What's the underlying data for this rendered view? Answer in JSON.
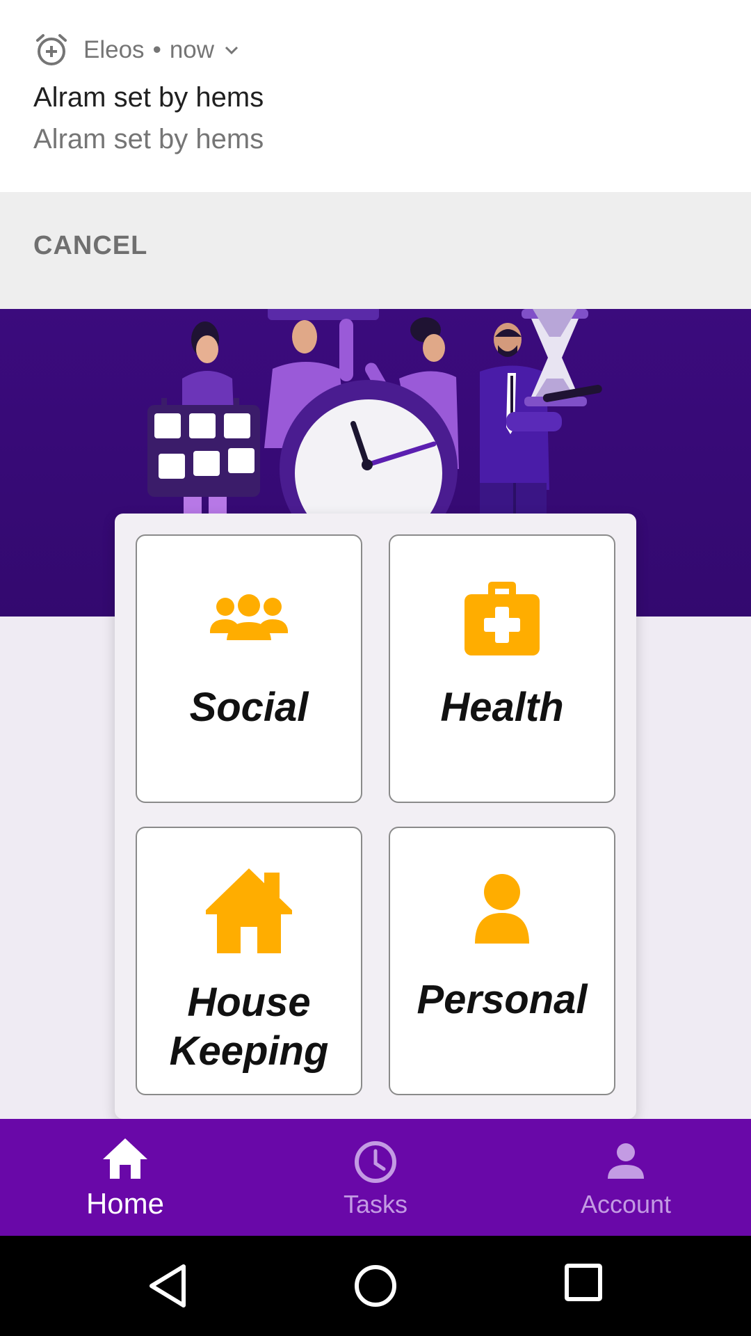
{
  "notification": {
    "app_name": "Eleos",
    "separator": "•",
    "time": "now",
    "title": "Alram set by hems",
    "text": "Alram set by hems",
    "action_cancel": "CANCEL"
  },
  "categories": [
    {
      "label": "Social",
      "icon": "people-icon"
    },
    {
      "label": "Health",
      "icon": "medical-kit-icon"
    },
    {
      "label_line1": "House",
      "label_line2": "Keeping",
      "icon": "house-icon"
    },
    {
      "label": "Personal",
      "icon": "person-icon"
    }
  ],
  "bottom_nav": {
    "items": [
      {
        "label": "Home",
        "icon": "home-icon",
        "active": true
      },
      {
        "label": "Tasks",
        "icon": "clock-icon",
        "active": false
      },
      {
        "label": "Account",
        "icon": "account-icon",
        "active": false
      }
    ]
  },
  "system_nav": [
    "back-icon",
    "home-circle-icon",
    "recents-icon"
  ],
  "colors": {
    "accent": "#ffad00",
    "nav_bg": "#6908a8",
    "hero_bg": "#3b0b7d",
    "nav_inactive": "#c39be3"
  }
}
